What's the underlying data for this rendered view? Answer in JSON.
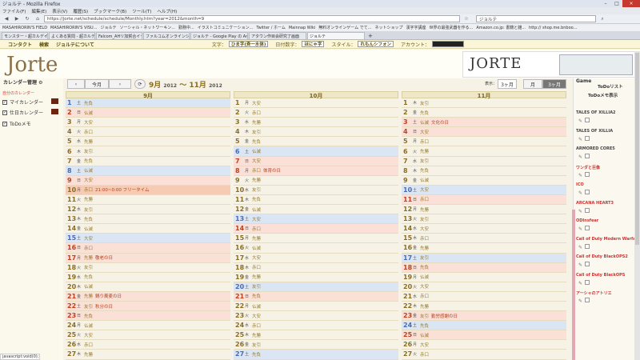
{
  "browser": {
    "title": "ジョルテ - Mozilla Firefox",
    "menu": [
      "ファイル(F)",
      "編集(E)",
      "表示(V)",
      "履歴(S)",
      "ブックマーク(B)",
      "ツール(T)",
      "ヘルプ(H)"
    ],
    "url": "https://jorte.net/schedule/schedule/Monthly.htm?year=2012&month=9",
    "search": "ジョルテ",
    "bookmarks": [
      "MASAHIRORIN'S FIELD",
      "MASAHIRORIN'S VISU...",
      "ジョルテ",
      "ソーシャル・ネットワーキン...",
      "勤務中...",
      "イラストコミュニケーション...",
      "Twitter / ホーム",
      "Mainnap Wiki",
      "無料オンラインゲーム でて...",
      "ネットショップ",
      "漢字字講座",
      "世界の最強武器を作る...",
      "Amazon.co.jp: 書籍と雑...",
      "http:// shop.me.bnboo..."
    ],
    "tabs": [
      "モンスター・超カルデイム ネクティェ ス...",
      "よくある質問 - 超カルデイム ネクティェ ス...",
      "Falcom_AHリ加賀合イース公式サイト...",
      "ファルコムオンラインショップ / イース セルセ...",
      "ジョルテ - Google Play の Android アプリ",
      "アタウン作目会研究了画面",
      "ジョルテ"
    ]
  },
  "appnav": {
    "links": [
      "コンタクト",
      "検索",
      "ジョルテについて"
    ],
    "font_label": "文字：",
    "font_value": "ひま字(斉一水体)",
    "date_label": "日付数字：",
    "date_value": "ほにゃ字",
    "style_label": "スタイル：",
    "style_value": "れもんシフォン",
    "account_label": "アカウント："
  },
  "logo": "Jorte",
  "banner": "JORTE",
  "sidebar": {
    "title": "カレンダー管理",
    "sub": "自分のカレンダー",
    "items": [
      "マイカレンダー",
      "仕日カレンダー",
      "ToDoメモ"
    ]
  },
  "toolbar": {
    "prev": "‹",
    "today": "今月",
    "next": "›",
    "refresh": "⟳",
    "range_a": "9月",
    "y1": "2012",
    "sep": " ～ ",
    "range_b": "11月",
    "y2": "2012",
    "show_label": "表示：",
    "show_value": "3ヶ月",
    "view_month": "月",
    "view_3": "3ヶ月"
  },
  "calendar": {
    "columns": [
      {
        "name": "9月",
        "days": [
          {
            "n": "1",
            "w": "土",
            "r": "先負",
            "t": "sat"
          },
          {
            "n": "2",
            "w": "日",
            "r": "仏滅",
            "t": "sun"
          },
          {
            "n": "3",
            "w": "月",
            "r": "大安"
          },
          {
            "n": "4",
            "w": "火",
            "r": "赤口"
          },
          {
            "n": "5",
            "w": "水",
            "r": "先勝"
          },
          {
            "n": "6",
            "w": "木",
            "r": "友引"
          },
          {
            "n": "7",
            "w": "金",
            "r": "先負"
          },
          {
            "n": "8",
            "w": "土",
            "r": "仏滅",
            "t": "sat"
          },
          {
            "n": "9",
            "w": "日",
            "r": "大安",
            "t": "sun"
          },
          {
            "n": "10",
            "w": "月",
            "r": "赤口",
            "e": "21:00~0:00 フリータイム",
            "t": "today"
          },
          {
            "n": "11",
            "w": "火",
            "r": "先勝"
          },
          {
            "n": "12",
            "w": "水",
            "r": "友引"
          },
          {
            "n": "13",
            "w": "木",
            "r": "先負"
          },
          {
            "n": "14",
            "w": "金",
            "r": "仏滅"
          },
          {
            "n": "15",
            "w": "土",
            "r": "大安",
            "t": "sat"
          },
          {
            "n": "16",
            "w": "日",
            "r": "赤口",
            "t": "sun"
          },
          {
            "n": "17",
            "w": "月",
            "r": "先勝",
            "e": "敬老の日",
            "t": "sun"
          },
          {
            "n": "18",
            "w": "火",
            "r": "友引"
          },
          {
            "n": "19",
            "w": "水",
            "r": "先負"
          },
          {
            "n": "20",
            "w": "木",
            "r": "仏滅"
          },
          {
            "n": "21",
            "w": "金",
            "r": "先勝",
            "e": "鍋り蕎麦の日",
            "t": "sun"
          },
          {
            "n": "22",
            "w": "土",
            "r": "友引",
            "e": "秋分の日",
            "t": "sun"
          },
          {
            "n": "23",
            "w": "日",
            "r": "先負",
            "t": "sun"
          },
          {
            "n": "24",
            "w": "月",
            "r": "仏滅"
          },
          {
            "n": "25",
            "w": "火",
            "r": "大安"
          },
          {
            "n": "26",
            "w": "水",
            "r": "赤口"
          },
          {
            "n": "27",
            "w": "木",
            "r": "先勝"
          }
        ]
      },
      {
        "name": "10月",
        "days": [
          {
            "n": "1",
            "w": "月",
            "r": "大安"
          },
          {
            "n": "2",
            "w": "火",
            "r": "赤口"
          },
          {
            "n": "3",
            "w": "水",
            "r": "先勝"
          },
          {
            "n": "4",
            "w": "木",
            "r": "友引"
          },
          {
            "n": "5",
            "w": "金",
            "r": "先負"
          },
          {
            "n": "6",
            "w": "土",
            "r": "仏滅",
            "t": "sat"
          },
          {
            "n": "7",
            "w": "日",
            "r": "大安",
            "t": "sun"
          },
          {
            "n": "8",
            "w": "月",
            "r": "赤口",
            "e": "体育の日",
            "t": "sun"
          },
          {
            "n": "9",
            "w": "火",
            "r": "先勝"
          },
          {
            "n": "10",
            "w": "水",
            "r": "友引"
          },
          {
            "n": "11",
            "w": "木",
            "r": "先負"
          },
          {
            "n": "12",
            "w": "金",
            "r": "仏滅"
          },
          {
            "n": "13",
            "w": "土",
            "r": "大安",
            "t": "sat"
          },
          {
            "n": "14",
            "w": "日",
            "r": "赤口",
            "t": "sun"
          },
          {
            "n": "15",
            "w": "月",
            "r": "先勝"
          },
          {
            "n": "16",
            "w": "火",
            "r": "仏滅"
          },
          {
            "n": "17",
            "w": "水",
            "r": "大安"
          },
          {
            "n": "18",
            "w": "木",
            "r": "赤口"
          },
          {
            "n": "19",
            "w": "金",
            "r": "先勝"
          },
          {
            "n": "20",
            "w": "土",
            "r": "友引",
            "t": "sat"
          },
          {
            "n": "21",
            "w": "日",
            "r": "先負",
            "t": "sun"
          },
          {
            "n": "22",
            "w": "月",
            "r": "仏滅"
          },
          {
            "n": "23",
            "w": "火",
            "r": "大安"
          },
          {
            "n": "24",
            "w": "水",
            "r": "赤口"
          },
          {
            "n": "25",
            "w": "木",
            "r": "先勝"
          },
          {
            "n": "26",
            "w": "金",
            "r": "友引"
          },
          {
            "n": "27",
            "w": "土",
            "r": "先負",
            "t": "sat"
          }
        ]
      },
      {
        "name": "11月",
        "days": [
          {
            "n": "1",
            "w": "木",
            "r": "友引"
          },
          {
            "n": "2",
            "w": "金",
            "r": "先負"
          },
          {
            "n": "3",
            "w": "土",
            "r": "仏滅",
            "e": "文化の日",
            "t": "sun"
          },
          {
            "n": "4",
            "w": "日",
            "r": "大安",
            "t": "sun"
          },
          {
            "n": "5",
            "w": "月",
            "r": "赤口"
          },
          {
            "n": "6",
            "w": "火",
            "r": "先勝"
          },
          {
            "n": "7",
            "w": "水",
            "r": "友引"
          },
          {
            "n": "8",
            "w": "木",
            "r": "先負"
          },
          {
            "n": "9",
            "w": "金",
            "r": "仏滅"
          },
          {
            "n": "10",
            "w": "土",
            "r": "大安",
            "t": "sat"
          },
          {
            "n": "11",
            "w": "日",
            "r": "赤口",
            "t": "sun"
          },
          {
            "n": "12",
            "w": "月",
            "r": "先勝"
          },
          {
            "n": "13",
            "w": "火",
            "r": "友引"
          },
          {
            "n": "14",
            "w": "水",
            "r": "大安"
          },
          {
            "n": "15",
            "w": "木",
            "r": "赤口"
          },
          {
            "n": "16",
            "w": "金",
            "r": "先勝"
          },
          {
            "n": "17",
            "w": "土",
            "r": "友引",
            "t": "sat"
          },
          {
            "n": "18",
            "w": "日",
            "r": "先負",
            "t": "sun"
          },
          {
            "n": "19",
            "w": "月",
            "r": "仏滅"
          },
          {
            "n": "20",
            "w": "火",
            "r": "大安"
          },
          {
            "n": "21",
            "w": "水",
            "r": "赤口"
          },
          {
            "n": "22",
            "w": "木",
            "r": "先勝"
          },
          {
            "n": "23",
            "w": "金",
            "r": "友引",
            "e": "勤労感謝の日",
            "t": "sun"
          },
          {
            "n": "24",
            "w": "土",
            "r": "先負",
            "t": "sat"
          },
          {
            "n": "25",
            "w": "日",
            "r": "仏滅",
            "t": "sun"
          },
          {
            "n": "26",
            "w": "月",
            "r": "大安"
          },
          {
            "n": "27",
            "w": "火",
            "r": "赤口"
          }
        ]
      }
    ]
  },
  "todo": {
    "game": "Game",
    "title1": "ToDoリスト",
    "title2": "ToDoメモ表示",
    "items": [
      "TALES OF XILLIA2",
      "TALES OF XILLIA",
      "ARMORED CORE5",
      "ワンダと巨像",
      "ICO",
      "ARCANA HEART3",
      "ODInsfear",
      "Call of Duty Modern Warfa~",
      "Call of Duty BlackOPS2",
      "Call of Duty BlackOPS",
      "アーシャのアトリエ"
    ]
  },
  "status": "javascript:void(0);"
}
